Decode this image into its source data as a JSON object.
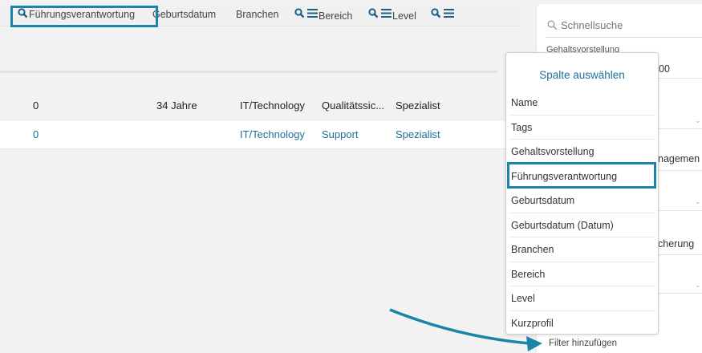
{
  "header": {
    "col_leadership": "Führungsverantwortung",
    "col_birthdate": "Geburtsdatum",
    "col_industries": "Branchen",
    "col_area": "Bereich",
    "col_level": "Level"
  },
  "rows": [
    {
      "leadership": "0",
      "age": "34 Jahre",
      "industry": "IT/Technology",
      "area": "Qualitätssic...",
      "level": "Spezialist"
    },
    {
      "leadership": "0",
      "age": "",
      "industry": "IT/Technology",
      "area": "Support",
      "level": "Spezialist"
    }
  ],
  "panel": {
    "search_placeholder": "Schnellsuche",
    "salary_label": "Gehaltsvorstellung",
    "frag_00": "00",
    "frag_management": "nagemen",
    "frag_insurance": "cherung",
    "add_filter": "Filter hinzufügen"
  },
  "dropdown": {
    "title": "Spalte auswählen",
    "items": [
      "Name",
      "Tags",
      "Gehaltsvorstellung",
      "Führungsverantwortung",
      "Geburtsdatum",
      "Geburtsdatum (Datum)",
      "Branchen",
      "Bereich",
      "Level",
      "Kurzprofil"
    ]
  },
  "colors": {
    "accent": "#1a85a8",
    "link": "#1d6f9a"
  },
  "icons": [
    "search-icon",
    "menu-icon",
    "chevron-down-icon"
  ]
}
